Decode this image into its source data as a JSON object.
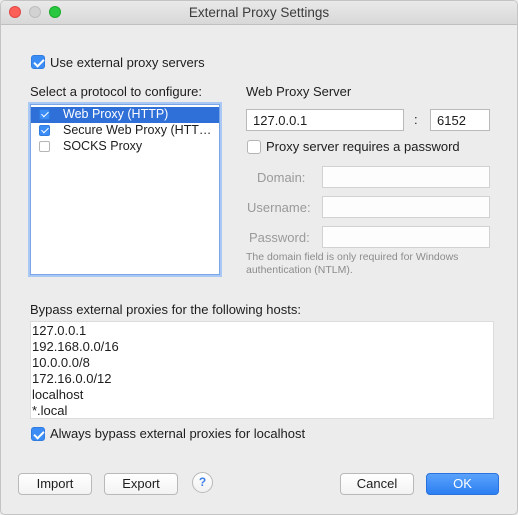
{
  "window": {
    "title": "External Proxy Settings"
  },
  "use_external": {
    "label": "Use external proxy servers",
    "checked": true
  },
  "protocols": {
    "heading": "Select a protocol to configure:",
    "items": [
      {
        "label": "Web Proxy (HTTP)",
        "checked": true,
        "selected": true
      },
      {
        "label": "Secure Web Proxy (HTTPS)",
        "checked": true,
        "selected": false
      },
      {
        "label": "SOCKS Proxy",
        "checked": false,
        "selected": false
      }
    ]
  },
  "server": {
    "heading": "Web Proxy Server",
    "host": "127.0.0.1",
    "separator": ":",
    "port": "6152",
    "requires_password_label": "Proxy server requires a password",
    "requires_password_checked": false,
    "domain_label": "Domain:",
    "username_label": "Username:",
    "password_label": "Password:",
    "hint": "The domain field is only required for Windows authentication (NTLM)."
  },
  "bypass": {
    "heading": "Bypass external proxies for the following hosts:",
    "hosts": [
      "127.0.0.1",
      "192.168.0.0/16",
      "10.0.0.0/8",
      "172.16.0.0/12",
      "localhost",
      "*.local"
    ],
    "localhost_label": "Always bypass external proxies for localhost",
    "localhost_checked": true
  },
  "buttons": {
    "import": "Import",
    "export": "Export",
    "help": "?",
    "cancel": "Cancel",
    "ok": "OK"
  },
  "colors": {
    "accent": "#2f6fd8",
    "checkbox": "#3b8df5",
    "ok_button": "#2c7ff2"
  }
}
